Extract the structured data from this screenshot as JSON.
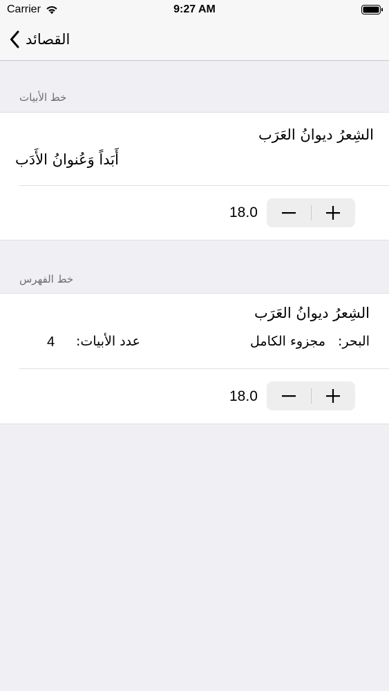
{
  "status_bar": {
    "carrier": "Carrier",
    "time": "9:27 AM",
    "wifi_icon": "wifi-icon",
    "battery_icon": "battery-icon"
  },
  "nav": {
    "back_label": "القصائد",
    "back_icon": "chevron-left-icon"
  },
  "verses_font": {
    "header": "خط الأبيات",
    "preview_line1": "الشِعرُ ديوانُ العَرَب",
    "preview_line2": "أَبَداً وَعُنوانُ الأَدَب",
    "value": "18.0"
  },
  "index_font": {
    "header": "خط الفهرس",
    "preview_title": "الشِعرُ ديوانُ العَرَب",
    "meter_label": "البحر:",
    "meter_value": "مجزوء الكامل",
    "count_label": "عدد الأبيات:",
    "count_value": "4",
    "value": "18.0"
  },
  "stepper": {
    "decrement_icon": "minus-icon",
    "increment_icon": "plus-icon"
  },
  "colors": {
    "background": "#efeff4",
    "cell": "#ffffff",
    "separator": "#e0e0e5",
    "section_header_text": "#6d6d72"
  }
}
